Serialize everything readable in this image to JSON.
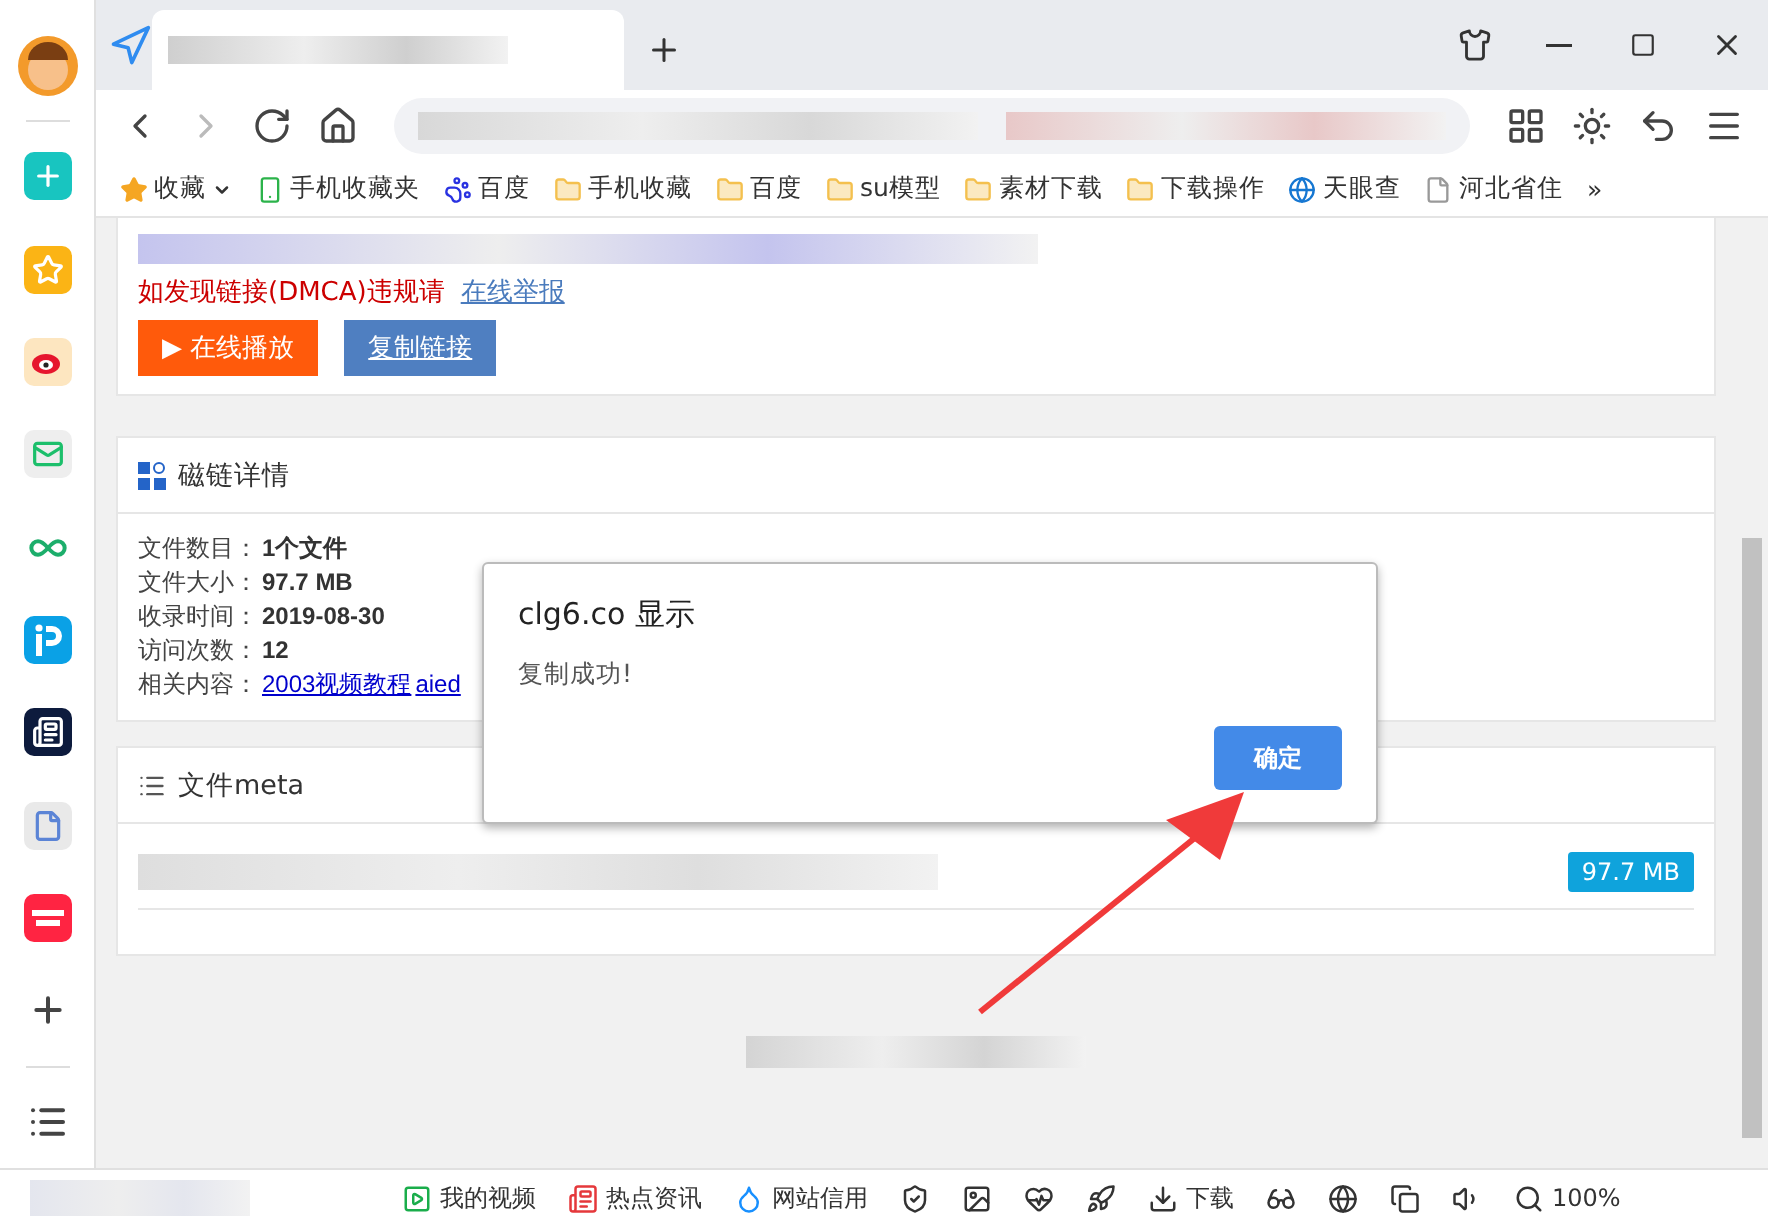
{
  "tabs": [
    {
      "kind": "blurred",
      "selected": true
    }
  ],
  "bookmarks": [
    {
      "kind": "star",
      "label": "收藏"
    },
    {
      "kind": "phone",
      "label": "手机收藏夹"
    },
    {
      "kind": "paw",
      "label": "百度"
    },
    {
      "kind": "folder",
      "label": "手机收藏"
    },
    {
      "kind": "folder",
      "label": "百度"
    },
    {
      "kind": "folder",
      "label": "su模型"
    },
    {
      "kind": "folder",
      "label": "素材下载"
    },
    {
      "kind": "folder",
      "label": "下载操作"
    },
    {
      "kind": "globe",
      "label": "天眼查"
    },
    {
      "kind": "page",
      "label": "河北省住"
    },
    {
      "kind": "more",
      "label": "»"
    }
  ],
  "card_top": {
    "notice": "如发现链接(DMCA)违规请",
    "report_link": "在线举报",
    "play_button": "▶ 在线播放",
    "copy_button": "复制链接"
  },
  "details": {
    "title": "磁链详情",
    "rows": [
      {
        "label": "文件数目：",
        "value": "1个文件"
      },
      {
        "label": "文件大小：",
        "value": "97.7 MB"
      },
      {
        "label": "收录时间：",
        "value": "2019-08-30"
      },
      {
        "label": "访问次数：",
        "value": "12"
      },
      {
        "label": "相关内容：",
        "links": [
          "2003视频教程",
          "aied"
        ]
      }
    ]
  },
  "meta": {
    "title": "文件meta",
    "size_badge": "97.7 MB"
  },
  "dialog": {
    "title": "clg6.co 显示",
    "message": "复制成功!",
    "ok_button": "确定"
  },
  "status_bar": [
    {
      "kind": "video",
      "label": "我的视频"
    },
    {
      "kind": "news",
      "label": "热点资讯"
    },
    {
      "kind": "drop",
      "label": "网站信用"
    },
    {
      "kind": "shield"
    },
    {
      "kind": "image"
    },
    {
      "kind": "heart"
    },
    {
      "kind": "rocket"
    },
    {
      "kind": "download",
      "label": "下载"
    },
    {
      "kind": "glasses"
    },
    {
      "kind": "ie"
    },
    {
      "kind": "window"
    },
    {
      "kind": "sound"
    },
    {
      "kind": "zoom",
      "label": "100%"
    }
  ]
}
